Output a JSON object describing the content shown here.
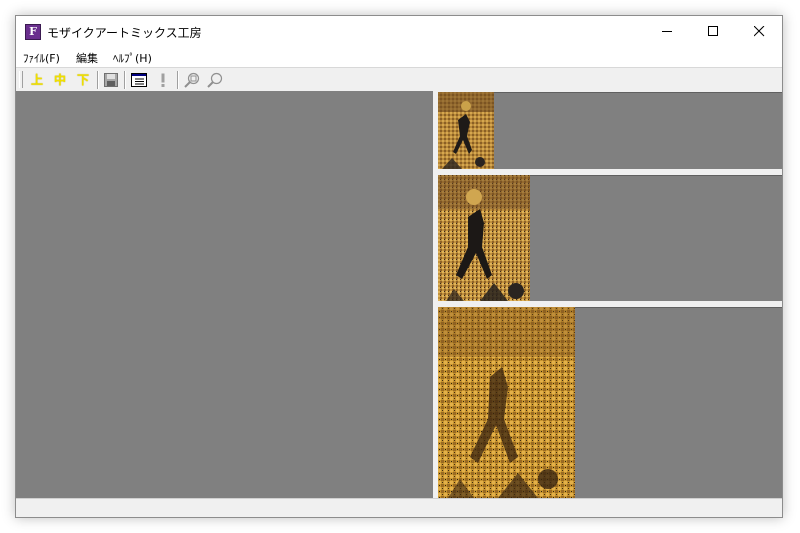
{
  "window": {
    "title": "モザイクアートミックス工房",
    "app_icon_letter": "F",
    "controls": {
      "minimize": "—",
      "maximize": "☐",
      "close": "✕"
    }
  },
  "menu": [
    {
      "label": "ﾌｧｲﾙ(F)"
    },
    {
      "label": "編集"
    },
    {
      "label": "ﾍﾙﾌﾟ(H)"
    }
  ],
  "toolbar": {
    "top_label": "上",
    "middle_label": "中",
    "bottom_label": "下",
    "icons": [
      "save-icon",
      "list-icon",
      "exclamation-icon",
      "zoom-fit-icon",
      "zoom-icon"
    ]
  },
  "colors": {
    "pane_background": "#808080",
    "window_background": "#f0f0f0",
    "toolbar_accent": "#f0e000"
  }
}
